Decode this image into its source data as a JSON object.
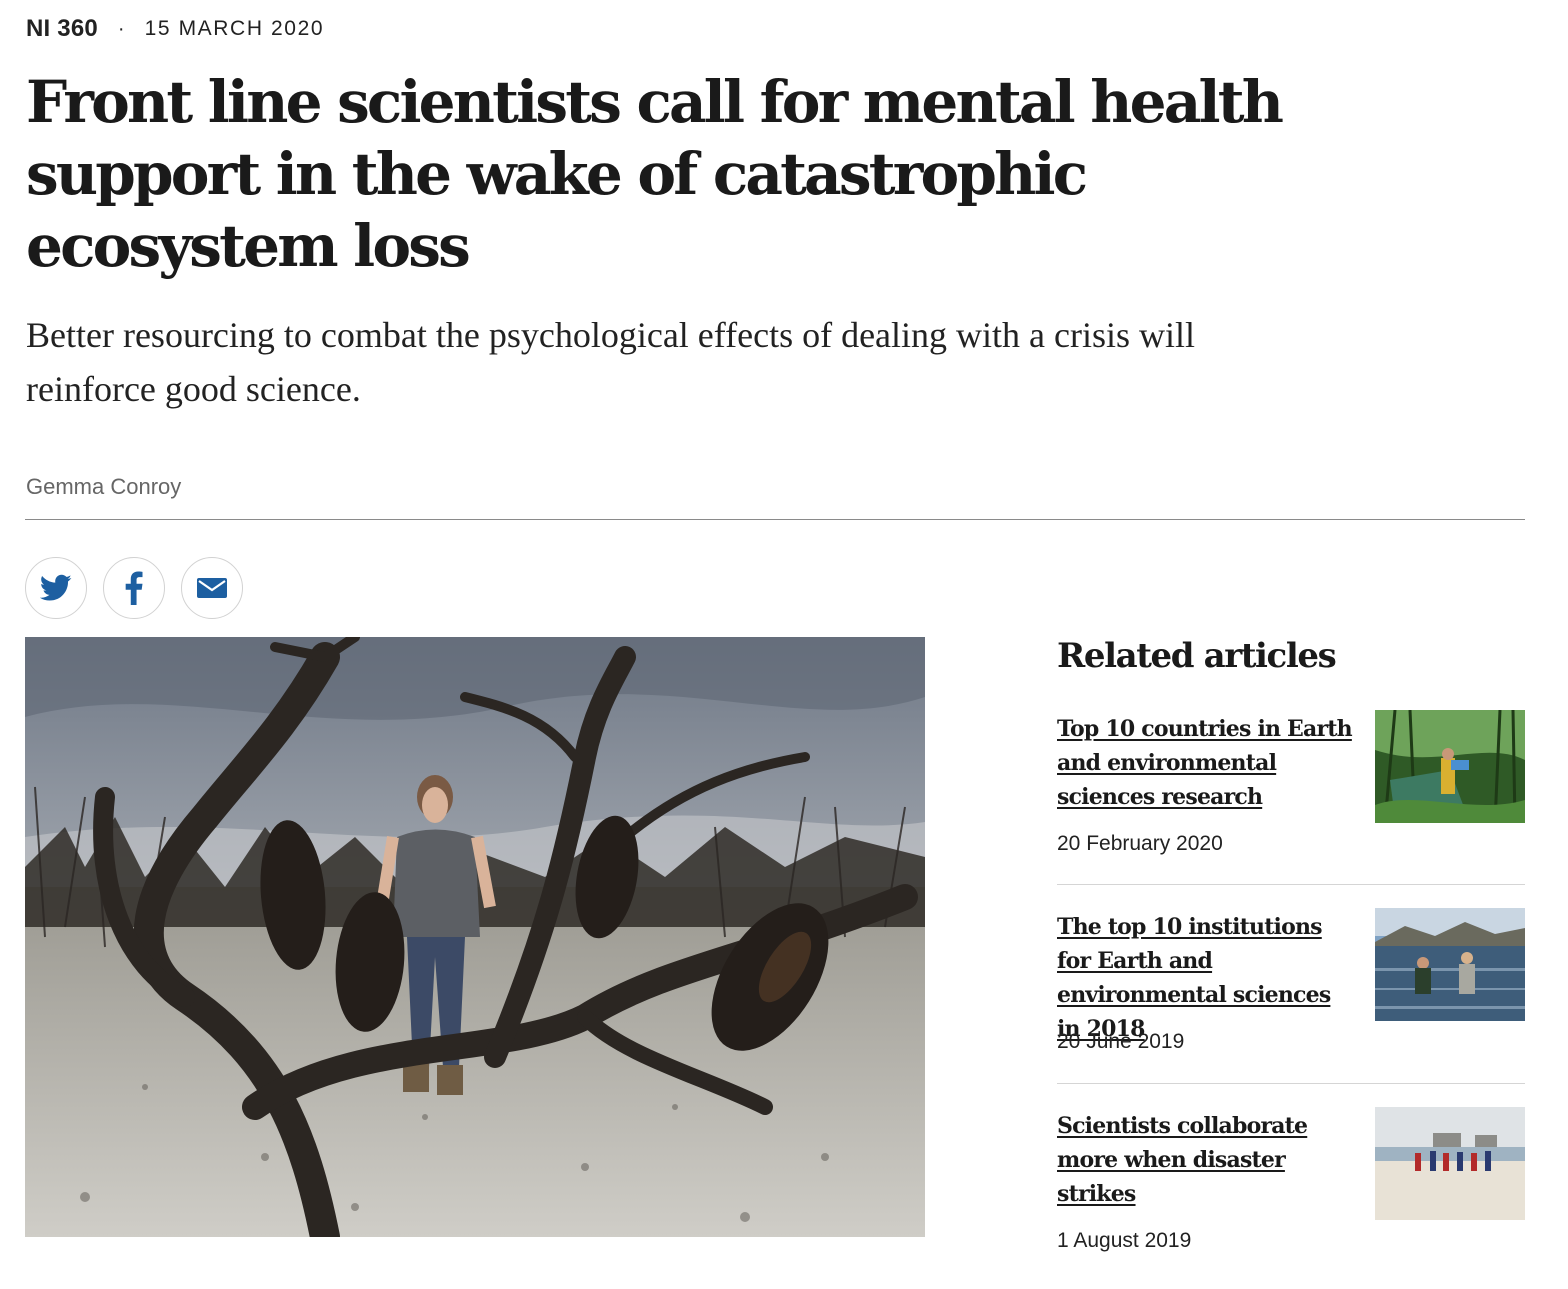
{
  "article": {
    "series": "NI 360",
    "separator": "·",
    "date": "15 MARCH 2020",
    "headline": "Front line scientists call for mental health support in the wake of catastrophic ecosystem loss",
    "standfirst": "Better resourcing to combat the psychological effects of dealing with a crisis will reinforce good science.",
    "author": "Gemma Conroy"
  },
  "share": {
    "items": [
      {
        "icon": "twitter-icon",
        "color": "#1d5fa1"
      },
      {
        "icon": "facebook-icon",
        "color": "#1d5fa1"
      },
      {
        "icon": "email-icon",
        "color": "#1d5fa1"
      }
    ]
  },
  "related": {
    "heading": "Related articles",
    "items": [
      {
        "title": "Top 10 countries in Earth and environmental sciences research",
        "date": "20 February 2020"
      },
      {
        "title": "The top 10 institutions for Earth and environmental sciences in 2018",
        "date": "20 June 2019"
      },
      {
        "title": "Scientists collaborate more when disaster strikes",
        "date": "1 August 2019"
      }
    ]
  },
  "colors": {
    "text": "#1a1a1a",
    "muted": "#666666",
    "accent": "#1d5fa1"
  }
}
